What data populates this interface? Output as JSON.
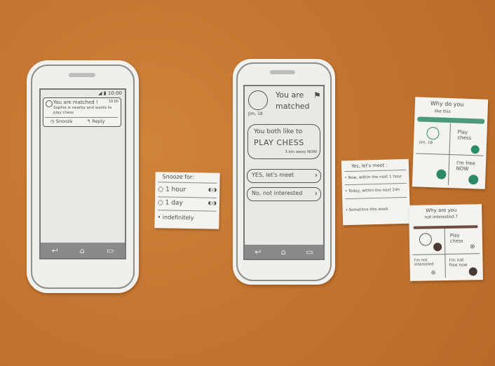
{
  "phone1": {
    "status_time": "10:00",
    "notif_title": "You are matched !",
    "notif_time": "10:00",
    "notif_body_line1": "Sophie is nearby and wants to",
    "notif_body_line2": "play chess",
    "snooze_label": "Snooze",
    "reply_label": "Reply",
    "nav_back": "↩",
    "nav_home": "⌂",
    "nav_recent": "▭"
  },
  "snooze_card": {
    "title": "Snooze for:",
    "options": [
      "1 hour",
      "1 day",
      "indefinitely"
    ]
  },
  "phone2": {
    "header_line1": "You are",
    "header_line2": "matched",
    "avatar_caption": "Jim, 18",
    "both_like": "You both like to",
    "activity": "PLAY CHESS",
    "distance": "3 km away NOW",
    "yes_button": "YES, let's meet",
    "no_button": "No, not interested",
    "nav_back": "↩",
    "nav_home": "⌂",
    "nav_recent": "▭"
  },
  "meet_card": {
    "title": "Yes, let's meet :",
    "options": [
      "Now, within the next 1 hour",
      "Today, within the next 24h",
      "Sometime this week"
    ]
  },
  "card_top": {
    "title_line1": "Why do you",
    "title_line2": "like this",
    "tag1": "Play chess",
    "tag2": "I'm free NOW",
    "tag3": "Jim, 18"
  },
  "card_bottom": {
    "title_line1": "Why are you",
    "title_line2": "not interested ?",
    "tag1": "Play chess",
    "tag2": "I'm not free now",
    "tag3": "I'm not interested"
  }
}
